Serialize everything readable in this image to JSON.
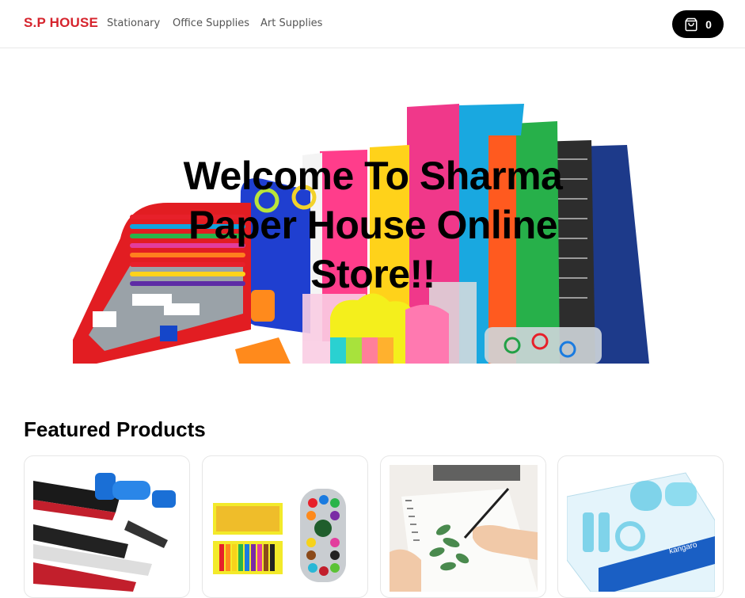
{
  "navbar": {
    "brand": "S.P HOUSE",
    "links": [
      "Stationary",
      "Office Supplies",
      "Art Supplies"
    ],
    "cart": {
      "icon": "shopping-bag-icon",
      "count": "0"
    }
  },
  "hero": {
    "title": "Welcome To Sharma Paper House Online Store!!",
    "image": "stationery-collection-image"
  },
  "featured": {
    "title": "Featured Products",
    "products": [
      {
        "image": "pencils-and-sharpener-image"
      },
      {
        "image": "watercolor-tubes-and-paint-set-image"
      },
      {
        "image": "hand-painting-leaves-image"
      },
      {
        "image": "kangaro-desk-organizer-image"
      }
    ]
  },
  "colors": {
    "brand": "#d6242d",
    "cart_button": "#000000",
    "text_muted": "#555555"
  }
}
